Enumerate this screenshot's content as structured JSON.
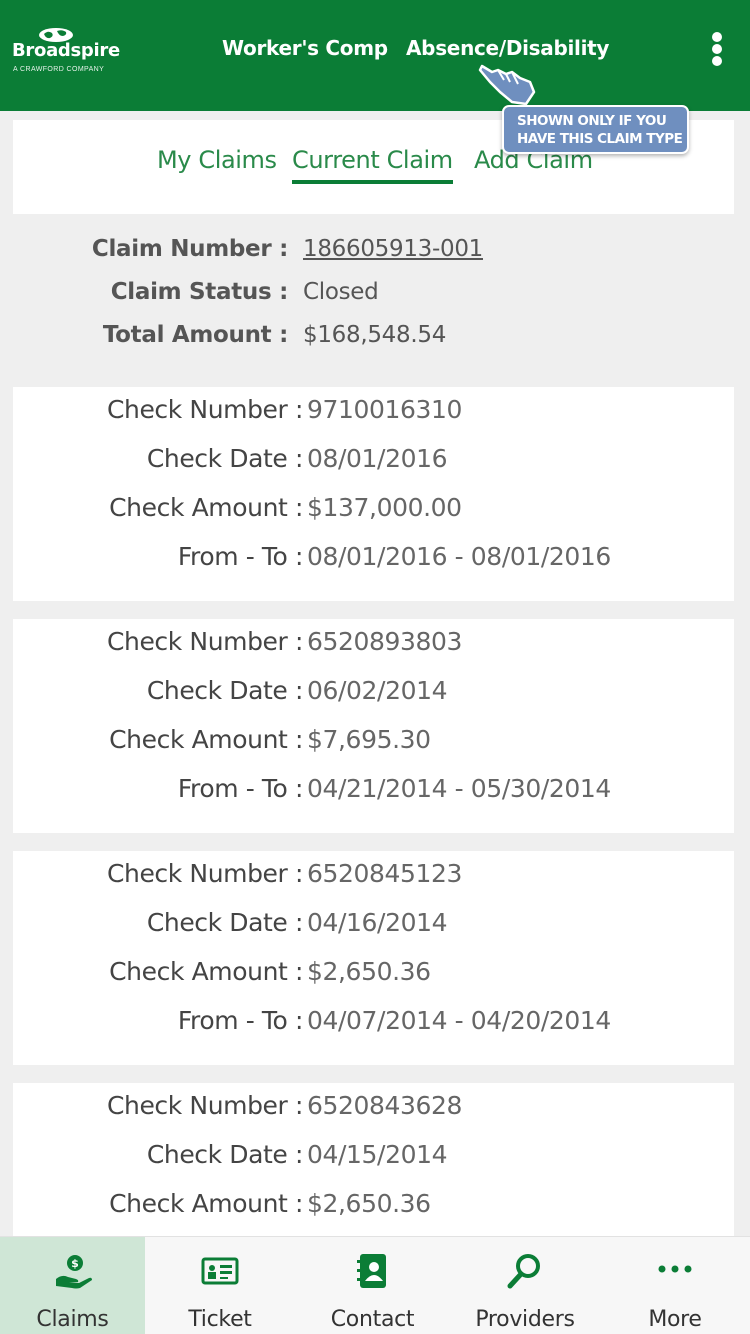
{
  "header": {
    "logo_brand": "Broadspire",
    "logo_sub": "A CRAWFORD COMPANY",
    "nav": [
      {
        "label": "Worker's Comp"
      },
      {
        "label": "Absence/Disability"
      }
    ],
    "menu_icon": "kebab-menu-icon"
  },
  "callout": {
    "line1": "SHOWN ONLY IF YOU",
    "line2": "HAVE THIS CLAIM TYPE"
  },
  "tabs": [
    {
      "label": "My Claims",
      "active": false
    },
    {
      "label": "Current Claim",
      "active": true
    },
    {
      "label": "Add Claim",
      "active": false
    }
  ],
  "summary": {
    "claim_number_label": "Claim Number :",
    "claim_number": "186605913-001",
    "claim_status_label": "Claim Status :",
    "claim_status": "Closed",
    "total_amount_label": "Total Amount :",
    "total_amount": "$168,548.54"
  },
  "check_labels": {
    "number": "Check Number :",
    "date": "Check Date :",
    "amount": "Check Amount :",
    "range": "From - To :"
  },
  "checks": [
    {
      "number": "9710016310",
      "date": "08/01/2016",
      "amount": "$137,000.00",
      "range": "08/01/2016 - 08/01/2016"
    },
    {
      "number": "6520893803",
      "date": "06/02/2014",
      "amount": "$7,695.30",
      "range": "04/21/2014 - 05/30/2014"
    },
    {
      "number": "6520845123",
      "date": "04/16/2014",
      "amount": "$2,650.36",
      "range": "04/07/2014 - 04/20/2014"
    },
    {
      "number": "6520843628",
      "date": "04/15/2014",
      "amount": "$2,650.36",
      "range": ""
    }
  ],
  "bottom_nav": [
    {
      "label": "Claims",
      "icon": "hand-dollar-icon",
      "active": true
    },
    {
      "label": "Ticket",
      "icon": "ticket-icon",
      "active": false
    },
    {
      "label": "Contact",
      "icon": "address-book-icon",
      "active": false
    },
    {
      "label": "Providers",
      "icon": "magnifier-icon",
      "active": false
    },
    {
      "label": "More",
      "icon": "ellipsis-icon",
      "active": false
    }
  ],
  "colors": {
    "brand_green": "#0b7d36",
    "tab_green": "#2a8a4a",
    "active_nav_bg": "#cfe6d6",
    "callout_blue": "#6f8fbf"
  }
}
